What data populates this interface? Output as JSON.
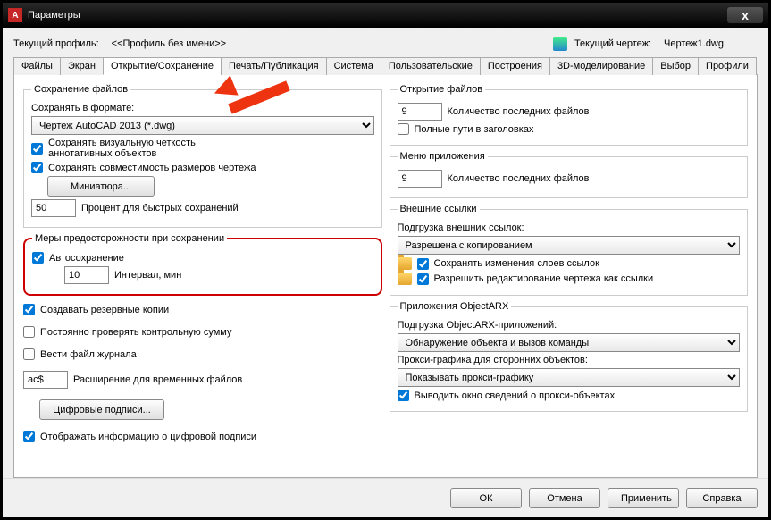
{
  "titlebar": {
    "app_letter": "A",
    "title": "Параметры",
    "close": "x"
  },
  "profile": {
    "label": "Текущий профиль:",
    "value": "<<Профиль без имени>>",
    "drawing_label": "Текущий чертеж:",
    "drawing_value": "Чертеж1.dwg"
  },
  "tabs": {
    "files": "Файлы",
    "screen": "Экран",
    "opensave": "Открытие/Сохранение",
    "plot": "Печать/Публикация",
    "system": "Система",
    "user": "Пользовательские",
    "draft": "Построения",
    "model3d": "3D-моделирование",
    "select": "Выбор",
    "profiles": "Профили"
  },
  "savefiles": {
    "legend": "Сохранение файлов",
    "save_as_label": "Сохранять в формате:",
    "format": "Чертеж AutoCAD 2013 (*.dwg)",
    "visual_fidelity": "Сохранять визуальную четкость аннотативных объектов",
    "size_compat": "Сохранять совместимость размеров чертежа",
    "thumbnail_btn": "Миниатюра...",
    "percent": "50",
    "percent_label": "Процент для быстрых сохранений"
  },
  "precaution": {
    "legend": "Меры предосторожности при сохранении",
    "autosave": "Автосохранение",
    "interval": "10",
    "interval_label": "Интервал, мин",
    "backup": "Создавать резервные копии",
    "crc": "Постоянно проверять контрольную сумму",
    "logfile": "Вести файл журнала",
    "ext": "ac$",
    "ext_label": "Расширение для временных файлов",
    "sig_btn": "Цифровые подписи...",
    "show_sig": "Отображать информацию о цифровой подписи"
  },
  "openfiles": {
    "legend": "Открытие файлов",
    "recent": "9",
    "recent_label": "Количество последних файлов",
    "fullpath": "Полные пути в заголовках"
  },
  "appmenu": {
    "legend": "Меню приложения",
    "recent": "9",
    "recent_label": "Количество последних файлов"
  },
  "xrefs": {
    "legend": "Внешние ссылки",
    "load_label": "Подгрузка внешних ссылок:",
    "load_value": "Разрешена с копированием",
    "retain_layers": "Сохранять изменения слоев ссылок",
    "allow_edit": "Разрешить редактирование чертежа как ссылки"
  },
  "arx": {
    "legend": "Приложения ObjectARX",
    "load_label": "Подгрузка ObjectARX-приложений:",
    "load_value": "Обнаружение объекта и вызов команды",
    "proxy_label": "Прокси-графика для сторонних объектов:",
    "proxy_value": "Показывать прокси-графику",
    "showbox": "Выводить окно сведений о прокси-объектах"
  },
  "footer": {
    "ok": "ОК",
    "cancel": "Отмена",
    "apply": "Применить",
    "help": "Справка"
  }
}
